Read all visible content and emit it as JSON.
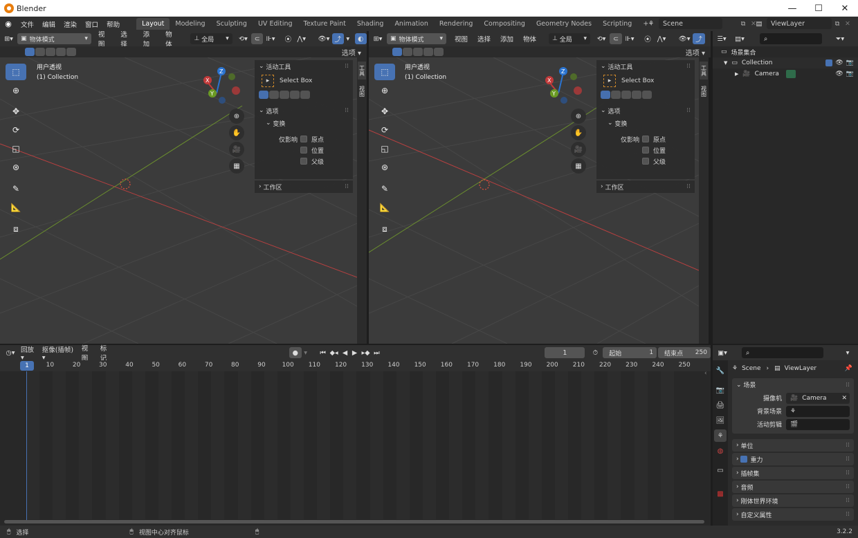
{
  "window": {
    "title": "Blender",
    "minimize": "—",
    "maximize": "☐",
    "close": "✕"
  },
  "menu": {
    "items": [
      "文件",
      "编辑",
      "渲染",
      "窗口",
      "帮助"
    ]
  },
  "workspaces": {
    "tabs": [
      "Layout",
      "Modeling",
      "Sculpting",
      "UV Editing",
      "Texture Paint",
      "Shading",
      "Animation",
      "Rendering",
      "Compositing",
      "Geometry Nodes",
      "Scripting"
    ],
    "add": "+"
  },
  "scene": {
    "name": "Scene",
    "view_layer": "ViewLayer"
  },
  "viewport_left": {
    "mode": "物体模式",
    "menus": [
      "视图",
      "选择",
      "添加",
      "物体"
    ],
    "orientation": "全局",
    "options": "选项",
    "view_name": "用户透视",
    "collection": "(1) Collection"
  },
  "viewport_right": {
    "mode": "物体模式",
    "menus": [
      "视图",
      "选择",
      "添加",
      "物体"
    ],
    "orientation": "全局",
    "options": "选项",
    "view_name": "用户透视",
    "collection": "(1) Collection"
  },
  "npanel": {
    "active_tool": "活动工具",
    "tool_name": "Select Box",
    "options": "选项",
    "transform": "变换",
    "affect_only": "仅影响",
    "origin": "原点",
    "location": "位置",
    "parents": "父级",
    "workspace": "工作区",
    "tab_tool": "工具",
    "tab_view": "视图"
  },
  "gizmo": {
    "z": "Z",
    "x": "X",
    "y": "Y"
  },
  "outliner": {
    "root": "场景集合",
    "collection": "Collection",
    "camera": "Camera"
  },
  "timeline": {
    "playback": "回放",
    "keying": "抠像(插帧)",
    "view": "视图",
    "marker": "标记",
    "current_frame": "1",
    "start_label": "起始",
    "start": "1",
    "end_label": "结束点",
    "end": "250",
    "ruler": [
      "1",
      "10",
      "20",
      "30",
      "40",
      "50",
      "60",
      "70",
      "80",
      "90",
      "100",
      "110",
      "120",
      "130",
      "140",
      "150",
      "160",
      "170",
      "180",
      "190",
      "200",
      "210",
      "220",
      "230",
      "240",
      "250"
    ]
  },
  "properties": {
    "breadcrumb_scene": "Scene",
    "breadcrumb_layer": "ViewLayer",
    "section_scene": "场景",
    "camera_label": "摄像机",
    "camera_value": "Camera",
    "bg_scene_label": "背景场景",
    "active_clip_label": "活动剪辑",
    "sections": [
      "单位",
      "重力",
      "插帧集",
      "音频",
      "刚体世界环境",
      "自定义属性"
    ]
  },
  "status": {
    "select": "选择",
    "center_view": "视图中心对齐鼠标",
    "version": "3.2.2"
  }
}
